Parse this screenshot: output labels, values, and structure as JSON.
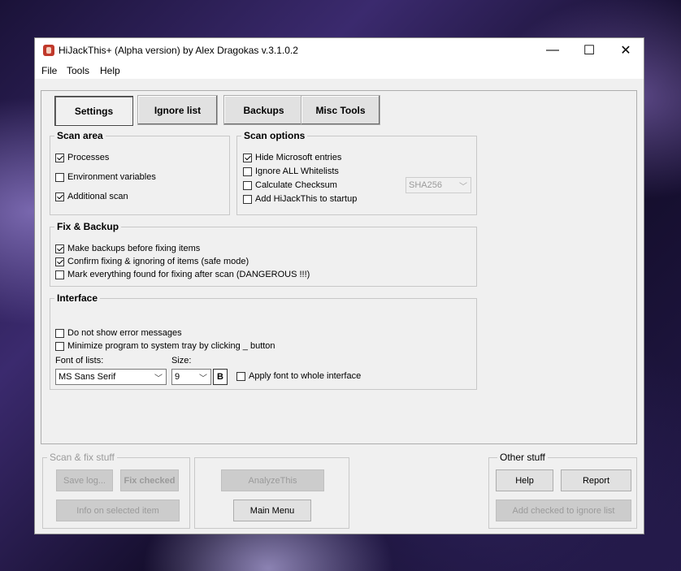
{
  "window": {
    "title": "HiJackThis+ (Alpha version) by Alex Dragokas v.3.1.0.2",
    "controls": {
      "minimize": "—",
      "maximize": "☐",
      "close": "✕"
    }
  },
  "menu": [
    "File",
    "Tools",
    "Help"
  ],
  "tabs": [
    {
      "label": "Settings",
      "active": true
    },
    {
      "label": "Ignore list",
      "active": false
    },
    {
      "label": "Backups",
      "active": false
    },
    {
      "label": "Misc Tools",
      "active": false
    }
  ],
  "scan_area": {
    "title": "Scan area",
    "items": [
      {
        "label": "Processes",
        "checked": true
      },
      {
        "label": "Environment variables",
        "checked": false
      },
      {
        "label": "Additional scan",
        "checked": true
      }
    ]
  },
  "scan_options": {
    "title": "Scan options",
    "items": [
      {
        "label": "Hide Microsoft entries",
        "checked": true
      },
      {
        "label": "Ignore ALL Whitelists",
        "checked": false
      },
      {
        "label": "Calculate Checksum",
        "checked": false
      },
      {
        "label": "Add HiJackThis to startup",
        "checked": false
      }
    ],
    "hash_select": "SHA256"
  },
  "fix_backup": {
    "title": "Fix & Backup",
    "items": [
      {
        "label": "Make backups before fixing items",
        "checked": true
      },
      {
        "label": "Confirm fixing & ignoring of items (safe mode)",
        "checked": true
      },
      {
        "label": "Mark everything found for fixing after scan (DANGEROUS !!!)",
        "checked": false
      }
    ]
  },
  "interface": {
    "title": "Interface",
    "items": [
      {
        "label": "Do not show error messages",
        "checked": false
      },
      {
        "label": "Minimize program to system tray by clicking _ button",
        "checked": false
      }
    ],
    "font_label": "Font of lists:",
    "font_value": "MS Sans Serif",
    "size_label": "Size:",
    "size_value": "9",
    "bold_label": "B",
    "apply_font": {
      "label": "Apply font to whole interface",
      "checked": false
    }
  },
  "bottom": {
    "scan_fix_title": "Scan & fix stuff",
    "save_log": "Save log...",
    "fix_checked": "Fix checked",
    "info_selected": "Info on selected item",
    "analyze": "AnalyzeThis",
    "main_menu": "Main Menu",
    "other_title": "Other stuff",
    "help": "Help",
    "report": "Report",
    "add_ignore": "Add checked to ignore list"
  }
}
